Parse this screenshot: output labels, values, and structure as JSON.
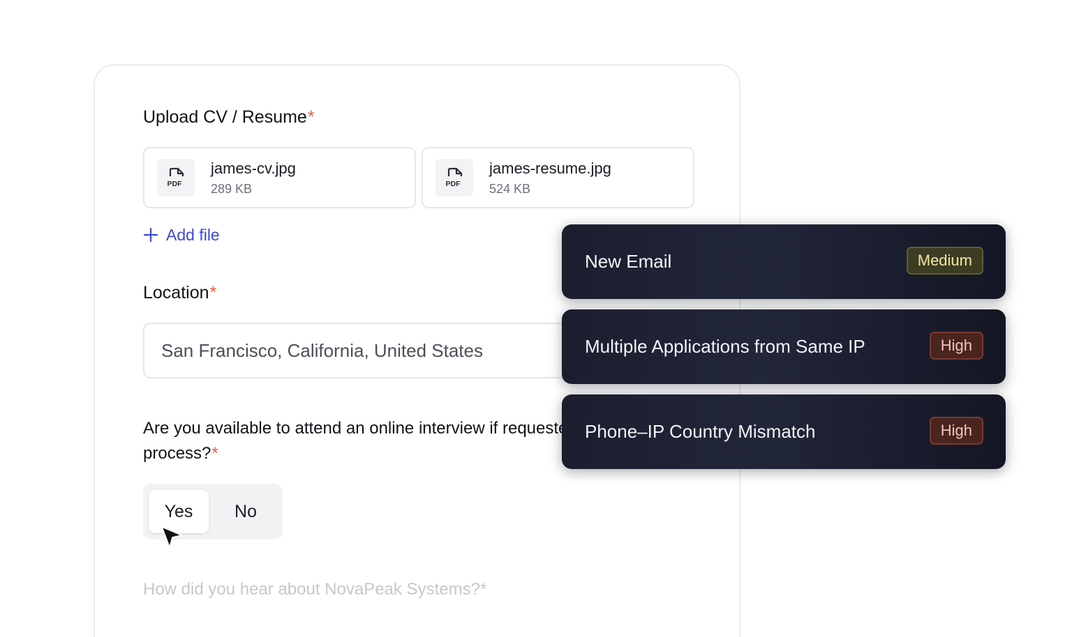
{
  "form": {
    "upload": {
      "label": "Upload CV / Resume",
      "required_mark": "*",
      "files": [
        {
          "name": "james-cv.jpg",
          "size": "289 KB",
          "icon": "pdf-file-icon",
          "icon_text": "PDF"
        },
        {
          "name": "james-resume.jpg",
          "size": "524 KB",
          "icon": "pdf-file-icon",
          "icon_text": "PDF"
        }
      ],
      "add_file_label": "Add file"
    },
    "location": {
      "label": "Location",
      "required_mark": "*",
      "value": "San Francisco, California, United States"
    },
    "interview": {
      "question": "Are you available to attend an online interview if requested as part of the hiring process?",
      "required_mark": "*",
      "options": [
        "Yes",
        "No"
      ],
      "selected": "Yes"
    },
    "referral": {
      "question": "How did you hear about NovaPeak Systems?*"
    }
  },
  "alerts": [
    {
      "title": "New Email",
      "severity": "Medium"
    },
    {
      "title": "Multiple Applications from Same IP",
      "severity": "High"
    },
    {
      "title": "Phone–IP Country Mismatch",
      "severity": "High"
    }
  ],
  "colors": {
    "accent": "#3b49d6",
    "required": "#ef5a3c",
    "alert_bg": "#1b1e2e",
    "medium_badge": "#f5e7a0",
    "high_badge": "#f6c5b8"
  }
}
